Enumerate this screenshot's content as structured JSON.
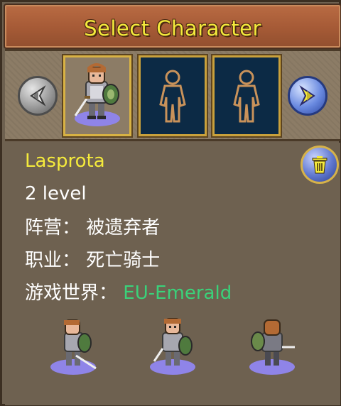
{
  "header": {
    "title": "Select Character"
  },
  "selector": {
    "prev_icon": "left-arrow-icon",
    "next_icon": "right-arrow-icon",
    "slots": [
      {
        "state": "selected",
        "icon": "knight-portrait-icon"
      },
      {
        "state": "empty",
        "icon": "empty-body-silhouette-icon"
      },
      {
        "state": "empty",
        "icon": "empty-body-silhouette-icon"
      }
    ]
  },
  "character": {
    "name": "Lasprota",
    "level": "2 level",
    "faction_label": "阵营：",
    "faction_value": "被遗弃者",
    "class_label": "职业：",
    "class_value": "死亡骑士",
    "realm_label": "游戏世界：",
    "realm_value": "EU-Emerald"
  },
  "actions": {
    "delete_icon": "trash-icon"
  },
  "colors": {
    "title": "#f4ea3c",
    "name": "#f4ea3c",
    "realm": "#3ad27a",
    "slot_border": "#d8b244",
    "empty_slot_bg": "#0c2a45",
    "panel_bg": "#6e6150"
  }
}
